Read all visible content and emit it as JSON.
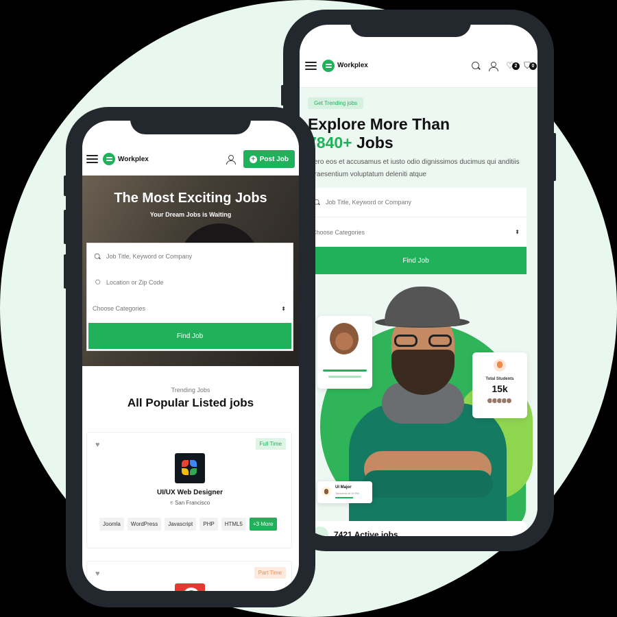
{
  "brand": {
    "name": "Workplex",
    "accent": "#21b15b",
    "background_circle": "#e8f8ee",
    "frame": "#23272e"
  },
  "right_phone": {
    "nav": {
      "logo": "Workplex",
      "icons": [
        "search-icon",
        "user-icon",
        "heart-icon",
        "cart-icon"
      ],
      "wishlist_count": "2",
      "cart_count": "0"
    },
    "hero": {
      "pill": "Get Trending jobs",
      "title_line1": "Explore More Than",
      "title_number": "7840+",
      "title_rest": " Jobs",
      "description": "vero eos et accusamus et iusto odio dignissimos ducimus qui anditiis praesentium voluptatum deleniti atque",
      "search_placeholder": "Job Title, Keyword or Company",
      "category_placeholder": "Choose Categories",
      "find_button": "Find Job"
    },
    "stats_card": {
      "label": "Total Students",
      "value": "15k"
    },
    "ui_card": {
      "title": "UI Major",
      "subtitle": "Tomorrow at 10 PM"
    },
    "active_jobs": "7421 Active jobs"
  },
  "left_phone": {
    "nav": {
      "logo": "Workplex",
      "post_button": "Post Job",
      "icons": [
        "hamburger-icon",
        "user-icon",
        "plus-icon"
      ]
    },
    "hero": {
      "title": "The Most Exciting Jobs",
      "subtitle": "Your Dream Jobs is Waiting",
      "search_placeholder": "Job Title, Keyword or Company",
      "location_placeholder": "Location or Zip Code",
      "category_placeholder": "Choose Categories",
      "find_button": "Find Job"
    },
    "section": {
      "eyebrow": "Trending Jobs",
      "heading": "All Popular Listed jobs"
    },
    "jobs": [
      {
        "type": "Full Time",
        "title": "UI/UX Web Designer",
        "location": "San Francisco",
        "tags": [
          "Joomla",
          "WordPress",
          "Javascript",
          "PHP",
          "HTML5"
        ],
        "more": "+3 More"
      },
      {
        "type": "Part Time"
      }
    ]
  }
}
